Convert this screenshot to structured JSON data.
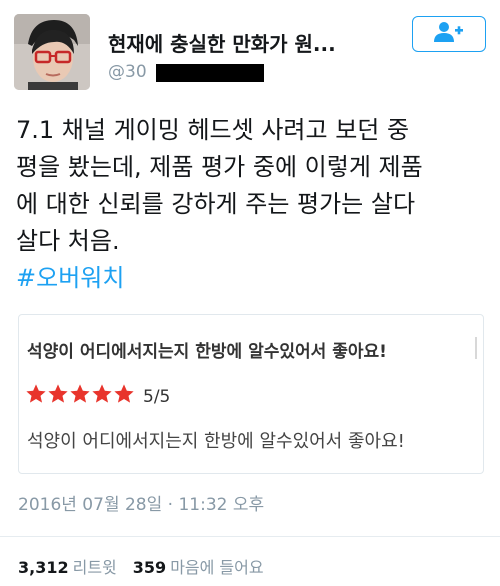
{
  "tweet": {
    "display_name": "현재에 충실한 만화가 원...",
    "handle_visible": "@30",
    "text_lines": [
      "7.1 채널 게이밍 헤드셋 사려고 보던 중",
      "평을 봤는데, 제품 평가 중에 이렇게 제품",
      "에 대한 신뢰를 강하게 주는 평가는 살다",
      "살다 처음."
    ],
    "hashtag": "#오버워치",
    "timestamp": "2016년 07월 28일 · 11:32 오후",
    "retweet_count": "3,312",
    "retweet_label": "리트윗",
    "like_count": "359",
    "like_label": "마음에 들어요"
  },
  "review_card": {
    "title": "석양이 어디에서지는지 한방에 알수있어서 좋아요!",
    "rating": 5,
    "rating_max": 5,
    "score_label": "5/5",
    "body": "석양이 어디에서지는지 한방에 알수있어서 좋아요!"
  },
  "icons": {
    "follow": "add-user-icon",
    "star": "star-icon"
  },
  "colors": {
    "accent": "#1da1f2",
    "star": "#e8342c",
    "muted": "#8899a6"
  }
}
